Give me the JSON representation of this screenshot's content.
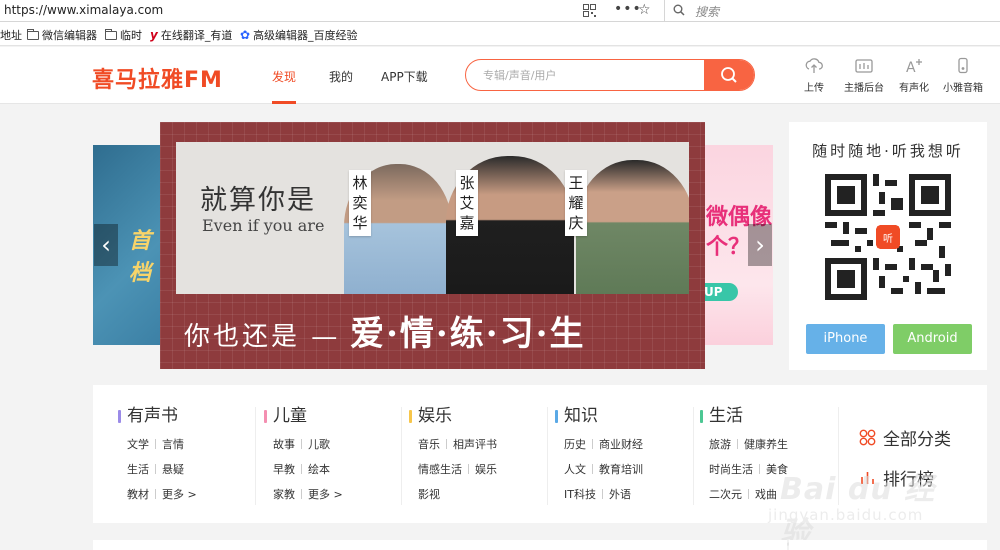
{
  "browser": {
    "url": "https://www.ximalaya.com",
    "more_glyph": "•••",
    "search_placeholder": "搜索"
  },
  "bookmarks": [
    {
      "label": "地址",
      "icon": "none"
    },
    {
      "label": "微信编辑器",
      "icon": "folder-icon"
    },
    {
      "label": "临时",
      "icon": "folder-icon"
    },
    {
      "label": "在线翻译_有道",
      "icon": "youdao-icon"
    },
    {
      "label": "高级编辑器_百度经验",
      "icon": "baidu-paw-icon"
    }
  ],
  "header": {
    "logo": "喜马拉雅FM",
    "nav": [
      "发现",
      "我的",
      "APP下载"
    ],
    "active_nav": "发现",
    "search_placeholder": "专辑/声音/用户",
    "tools": [
      {
        "label": "上传",
        "icon": "upload-cloud-icon"
      },
      {
        "label": "主播后台",
        "icon": "dashboard-icon"
      },
      {
        "label": "有声化",
        "icon": "text-to-audio-icon"
      },
      {
        "label": "小雅音箱",
        "icon": "speaker-icon"
      }
    ],
    "accent": "#f04b25"
  },
  "banner": {
    "headline": "就算你是",
    "subline": "Even if you are",
    "footer_left": "你也还是 —",
    "footer_right": "爱·情·练·习·生",
    "names": [
      "林奕华",
      "张艾嘉",
      "王耀庆"
    ],
    "left_peek_text": "首档",
    "right_peek_text": "微偶像\n个？",
    "right_peek_pill": "UP",
    "prev_glyph": "‹",
    "next_glyph": "›"
  },
  "app_card": {
    "slogan": "随时随地·听我想听",
    "qr_center": "听",
    "ios_label": "iPhone",
    "android_label": "Android",
    "ios_color": "#66b1e8",
    "android_color": "#7fcd67"
  },
  "categories": [
    {
      "title": "有声书",
      "color": "#9b8be8",
      "rows": [
        [
          "文学",
          "言情"
        ],
        [
          "生活",
          "悬疑"
        ],
        [
          "教材",
          "更多 >"
        ]
      ]
    },
    {
      "title": "儿童",
      "color": "#f48fb1",
      "rows": [
        [
          "故事",
          "儿歌"
        ],
        [
          "早教",
          "绘本"
        ],
        [
          "家教",
          "更多 >"
        ]
      ]
    },
    {
      "title": "娱乐",
      "color": "#f7c64b",
      "rows": [
        [
          "音乐",
          "相声评书"
        ],
        [
          "情感生活",
          "娱乐"
        ],
        [
          "影视"
        ]
      ]
    },
    {
      "title": "知识",
      "color": "#5aa9e6",
      "rows": [
        [
          "历史",
          "商业财经"
        ],
        [
          "人文",
          "教育培训"
        ],
        [
          "IT科技",
          "外语"
        ]
      ]
    },
    {
      "title": "生活",
      "color": "#4cc793",
      "rows": [
        [
          "旅游",
          "健康养生"
        ],
        [
          "时尚生活",
          "美食"
        ],
        [
          "二次元",
          "戏曲"
        ]
      ]
    }
  ],
  "side_links": [
    {
      "label": "全部分类",
      "icon": "grid-icon"
    },
    {
      "label": "排行榜",
      "icon": "rank-icon"
    }
  ],
  "watermark": {
    "logo": "Bai du 经验",
    "url": "jingyan.baidu.com"
  }
}
